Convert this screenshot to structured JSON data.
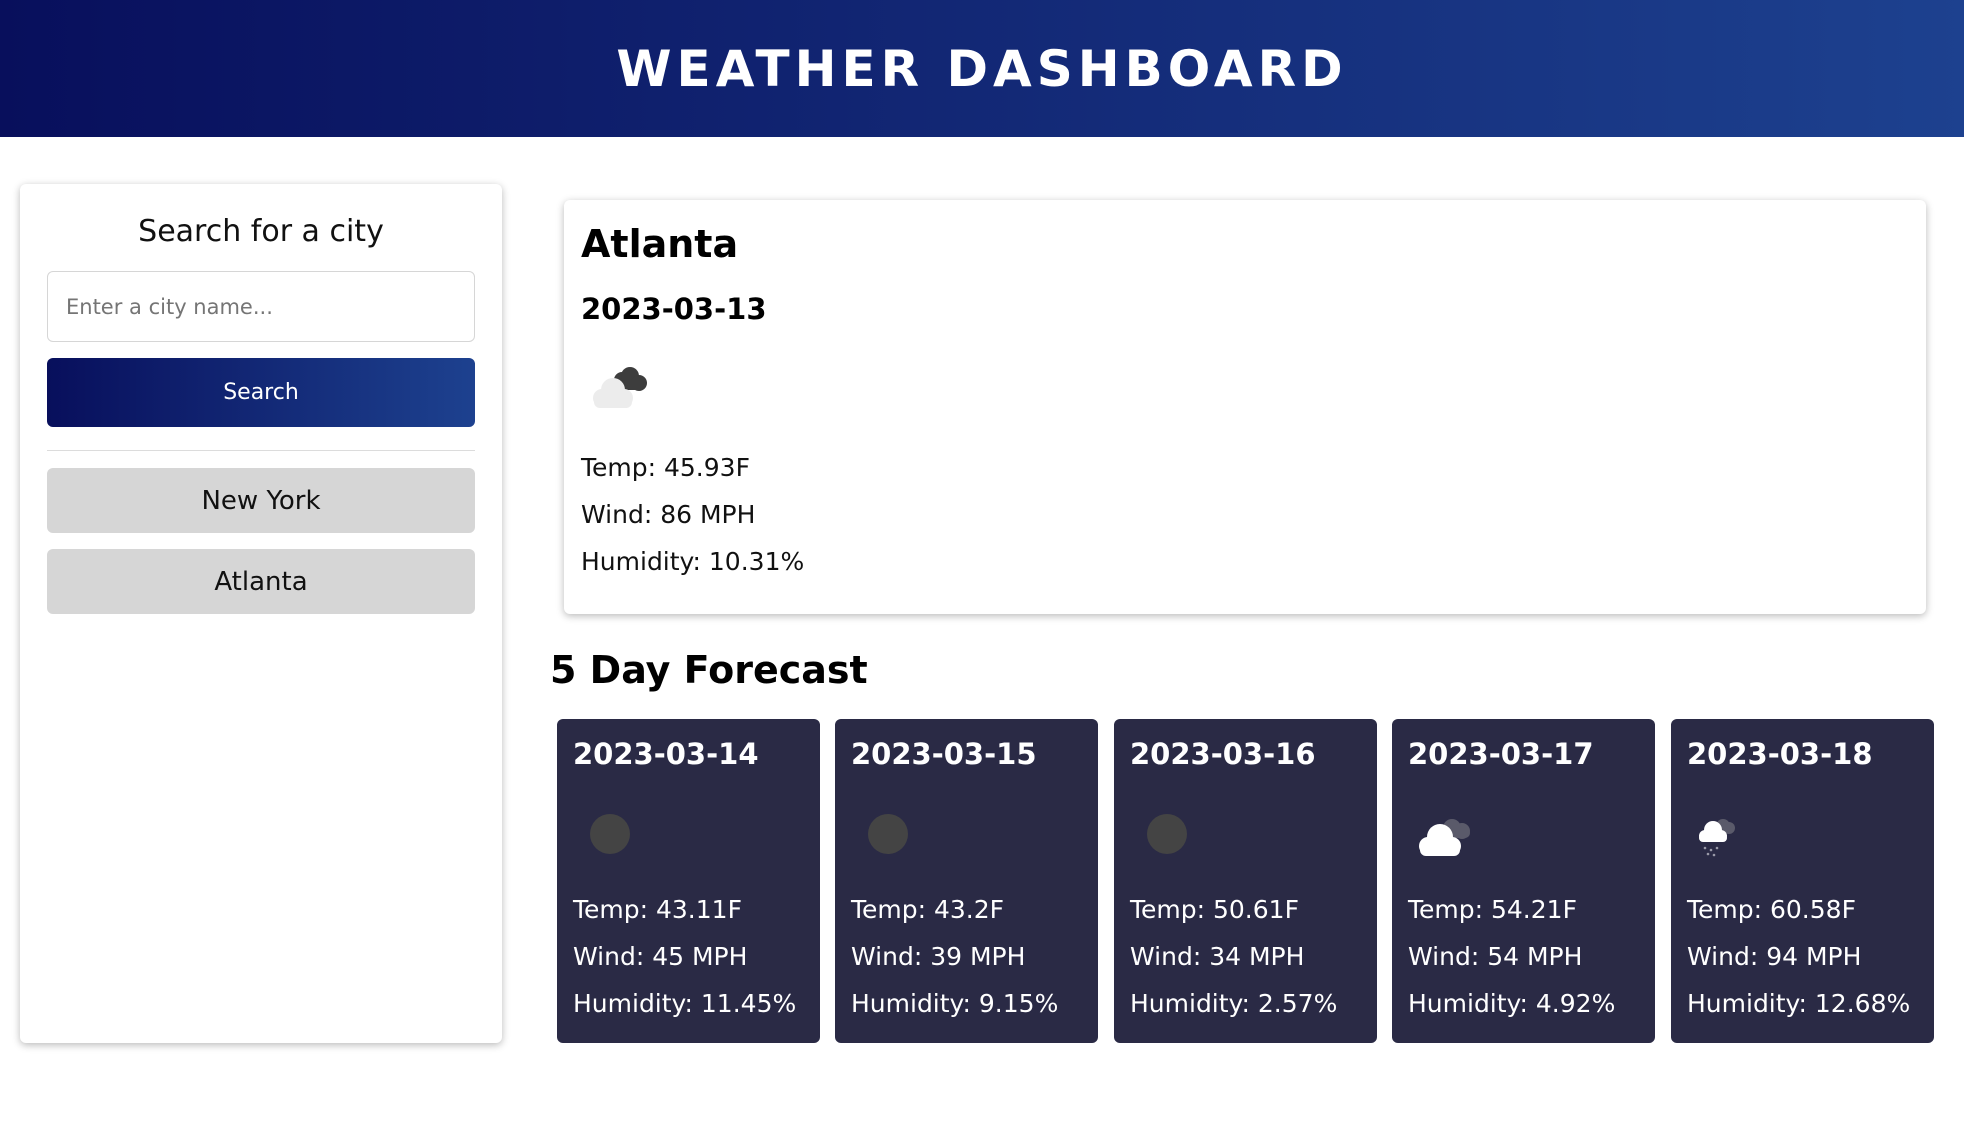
{
  "header": {
    "title": "WEATHER DASHBOARD"
  },
  "sidebar": {
    "heading": "Search for a city",
    "search": {
      "placeholder": "Enter a city name...",
      "value": ""
    },
    "search_button_label": "Search",
    "history": [
      "New York",
      "Atlanta"
    ]
  },
  "current": {
    "city": "Atlanta",
    "date": "2023-03-13",
    "icon": "cloud-icon",
    "temp": "Temp: 45.93F",
    "wind": "Wind: 86 MPH",
    "humidity": "Humidity: 10.31%"
  },
  "forecast": {
    "title": "5 Day Forecast",
    "days": [
      {
        "date": "2023-03-14",
        "icon": "moon-icon",
        "temp": "Temp: 43.11F",
        "wind": "Wind: 45 MPH",
        "humidity": "Humidity: 11.45%"
      },
      {
        "date": "2023-03-15",
        "icon": "moon-icon",
        "temp": "Temp: 43.2F",
        "wind": "Wind: 39 MPH",
        "humidity": "Humidity: 9.15%"
      },
      {
        "date": "2023-03-16",
        "icon": "moon-icon",
        "temp": "Temp: 50.61F",
        "wind": "Wind: 34 MPH",
        "humidity": "Humidity: 2.57%"
      },
      {
        "date": "2023-03-17",
        "icon": "cloud-icon",
        "temp": "Temp: 54.21F",
        "wind": "Wind: 54 MPH",
        "humidity": "Humidity: 4.92%"
      },
      {
        "date": "2023-03-18",
        "icon": "rain-cloud-icon",
        "temp": "Temp: 60.58F",
        "wind": "Wind: 94 MPH",
        "humidity": "Humidity: 12.68%"
      }
    ]
  },
  "colors": {
    "header_gradient_start": "#080f5c",
    "header_gradient_end": "#1d418f",
    "forecast_card_bg": "#2a2a45",
    "history_button_bg": "#d6d6d6"
  }
}
